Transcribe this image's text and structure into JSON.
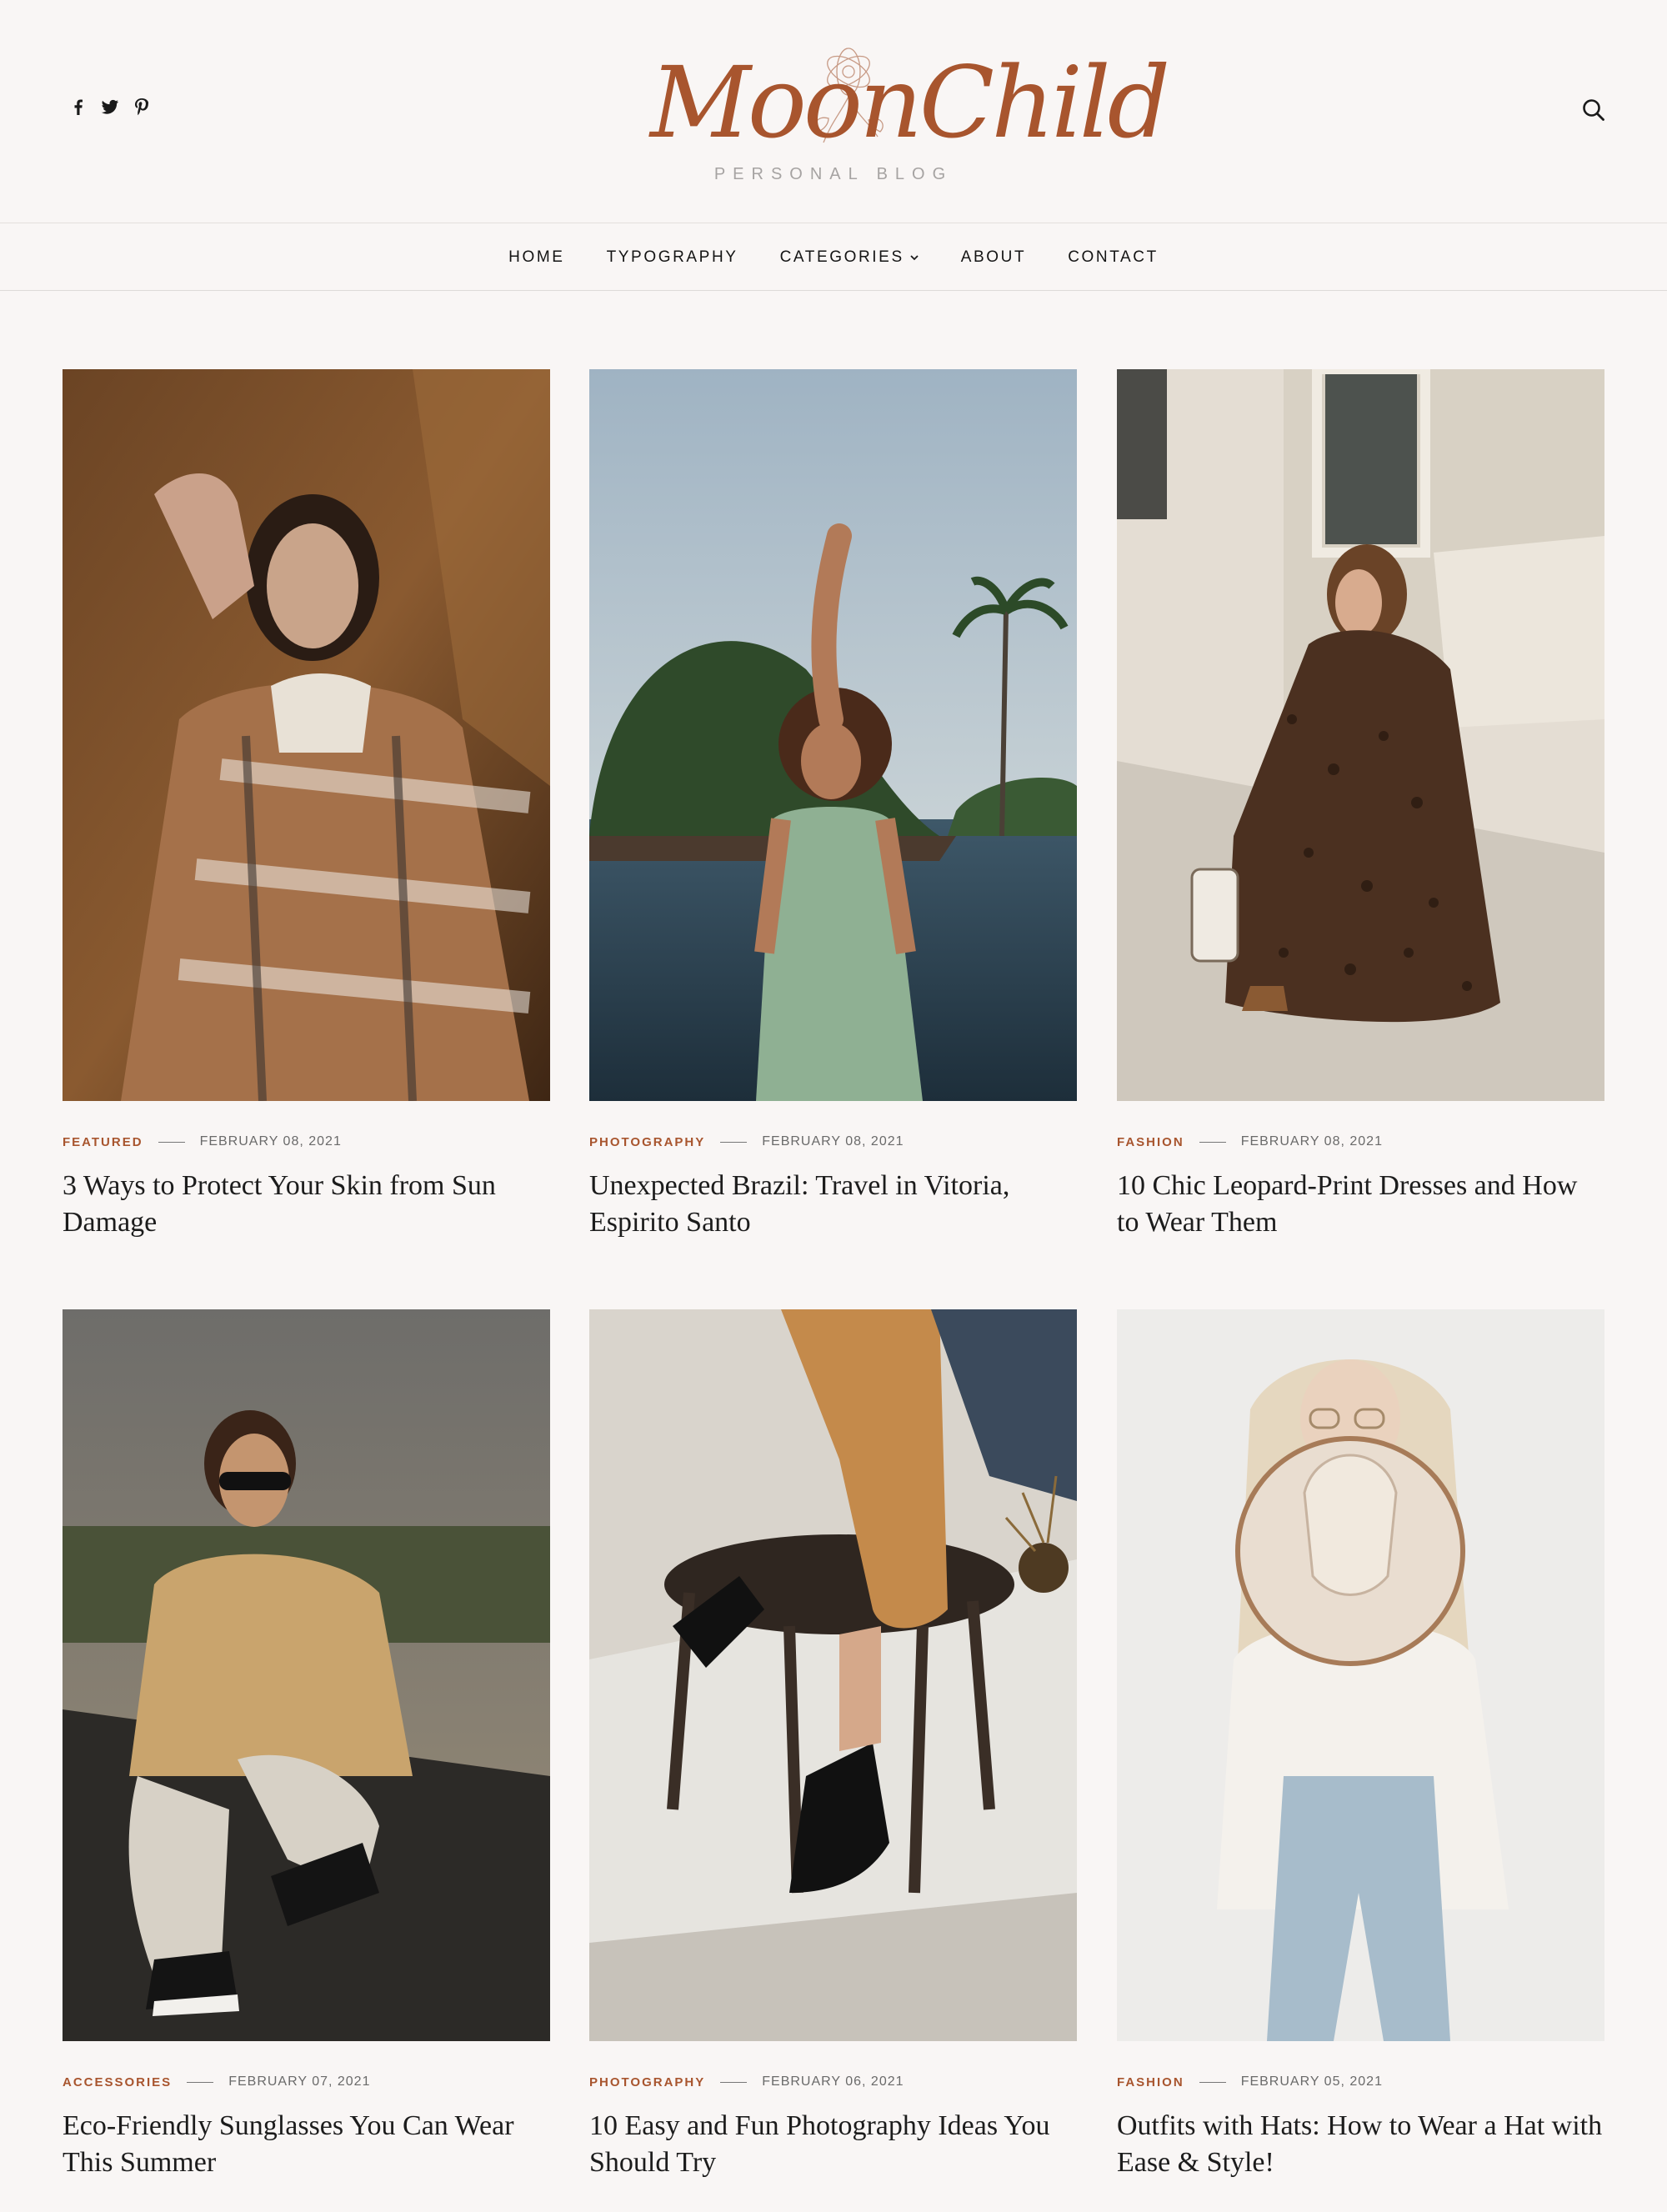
{
  "header": {
    "logo_text": "MoonChild",
    "tagline": "PERSONAL BLOG",
    "social": [
      "facebook-icon",
      "twitter-icon",
      "pinterest-icon"
    ],
    "search_icon": "search-icon"
  },
  "nav": {
    "items": [
      {
        "label": "HOME"
      },
      {
        "label": "TYPOGRAPHY"
      },
      {
        "label": "CATEGORIES",
        "dropdown": true
      },
      {
        "label": "ABOUT"
      },
      {
        "label": "CONTACT"
      }
    ]
  },
  "posts": [
    {
      "category": "FEATURED",
      "date": "FEBRUARY 08, 2021",
      "title": "3 Ways to Protect Your Skin from Sun Damage"
    },
    {
      "category": "PHOTOGRAPHY",
      "date": "FEBRUARY 08, 2021",
      "title": "Unexpected Brazil: Travel in Vitoria, Espirito Santo"
    },
    {
      "category": "FASHION",
      "date": "FEBRUARY 08, 2021",
      "title": "10 Chic Leopard-Print Dresses and How to Wear Them"
    },
    {
      "category": "ACCESSORIES",
      "date": "FEBRUARY 07, 2021",
      "title": "Eco-Friendly Sunglasses You Can Wear This Summer"
    },
    {
      "category": "PHOTOGRAPHY",
      "date": "FEBRUARY 06, 2021",
      "title": "10 Easy and Fun Photography Ideas You Should Try"
    },
    {
      "category": "FASHION",
      "date": "FEBRUARY 05, 2021",
      "title": "Outfits with Hats: How to Wear a Hat with Ease & Style!"
    }
  ],
  "colors": {
    "accent": "#a8552e",
    "background": "#f9f6f5",
    "text": "#1a1a1a"
  }
}
